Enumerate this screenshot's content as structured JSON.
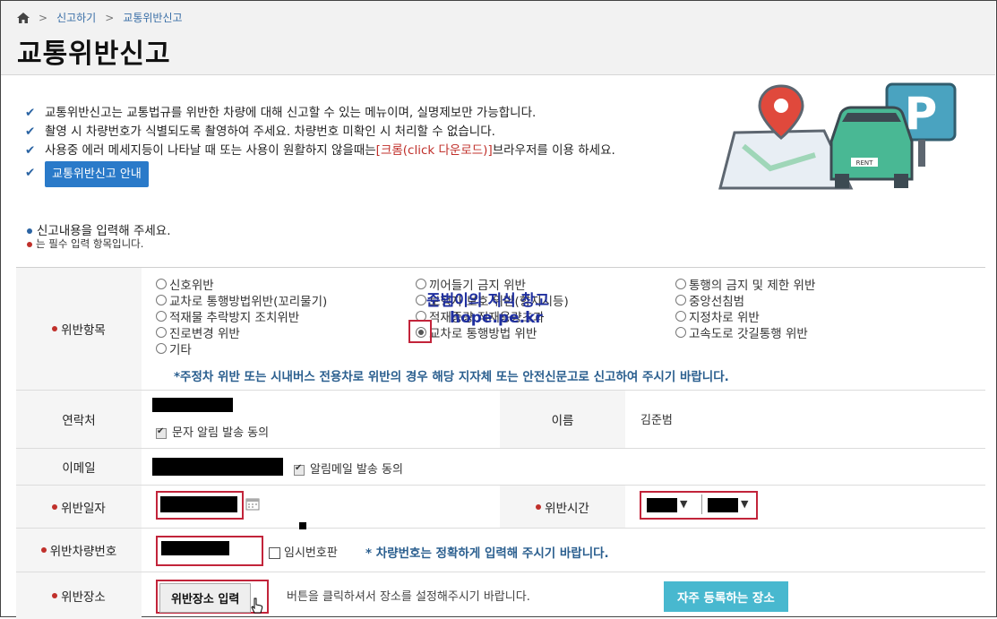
{
  "breadcrumb": {
    "home_icon": "home-icon",
    "items": [
      "신고하기",
      "교통위반신고"
    ]
  },
  "page_title": "교통위반신고",
  "notes": [
    "교통위반신고는 교통법규를 위반한 차량에 대해 신고할 수 있는 메뉴이며, 실명제보만 가능합니다.",
    "촬영 시 차량번호가 식별되도록 촬영하여 주세요. 차량번호 미확인 시 처리할 수 없습니다."
  ],
  "note3": {
    "before": "사용중 에러 메세지등이 나타날 때 또는 사용이 원활하지 않을때는 ",
    "link": "[크롬(click 다운로드)]",
    "after": "브라우저를 이용 하세요."
  },
  "guide_button": "교통위반신고 안내",
  "hint": {
    "main": "신고내용을 입력해 주세요.",
    "required": "는 필수 입력 항목입니다."
  },
  "violation": {
    "label": "위반항목",
    "options": {
      "col1": [
        "신호위반",
        "교차로 통행방법위반(꼬리물기)",
        "적재물 추락방지 조치위반",
        "진로변경 위반",
        "기타"
      ],
      "col2": [
        "끼어들기 금지 위반",
        "보행자 보호 위반(향지시등)",
        "적재중량 적재용량초과",
        "교차로 통행방법 위반"
      ],
      "col3": [
        "통행의 금지 및 제한 위반",
        "중앙선침범",
        "지정차로 위반",
        "고속도로 갓길통행 위반"
      ]
    },
    "selected": "교차로 통행방법 위반",
    "notice": "*주정차 위반 또는 시내버스 전용차로 위반의 경우 해당 지자체 또는 안전신문고로 신고하여 주시기 바랍니다."
  },
  "watermark": {
    "line1": "준범이의 지식 창고",
    "line2": "hope.pe.kr"
  },
  "contact": {
    "label": "연락처",
    "sms_consent": "문자 알림 발송 동의",
    "name_label": "이름",
    "name_value": "김준범"
  },
  "email": {
    "label": "이메일",
    "mail_consent": "알림메일 발송 동의"
  },
  "date": {
    "label": "위반일자",
    "time_label": "위반시간"
  },
  "plate": {
    "label": "위반차량번호",
    "temp_label": "임시번호판",
    "note": "* 차량번호는 정확하게 입력해 주시기 바랍니다."
  },
  "place": {
    "label": "위반장소",
    "button": "위반장소 입력",
    "help": "버튼을 클릭하셔서 장소를 설정해주시기 바랍니다.",
    "frequent": "자주 등록하는 장소"
  },
  "colors": {
    "accent": "#2a7ac9",
    "required_dot": "#c0302b",
    "highlight_border": "#c2243a",
    "frequent_button": "#48b8cf"
  }
}
